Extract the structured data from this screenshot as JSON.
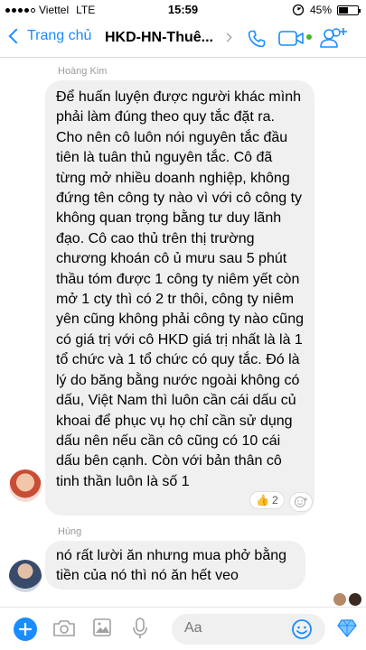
{
  "status_bar": {
    "carrier": "Viettel",
    "network": "LTE",
    "time": "15:59",
    "battery_percent": "45%",
    "battery_level": 0.45
  },
  "nav": {
    "back_label": "Trang chủ",
    "title": "HKD-HN-Thuê...",
    "icons": [
      "phone-icon",
      "video-icon",
      "add-people-icon"
    ]
  },
  "messages": [
    {
      "sender": "Hoàng Kim",
      "text": "Để huấn luyện được người khác mình phải làm đúng theo quy tắc đặt ra. Cho nên cô luôn nói nguyên tắc đầu tiên là tuân thủ nguyên tắc. Cô đã từng mở nhiều doanh nghiệp, không đứng tên công ty nào vì với cô công ty không quan trọng bằng tư duy lãnh đạo. Cô cao thủ trên thị trường chương khoán cô ủ mưu sau 5 phút thầu tóm được 1 công ty niêm yết còn mở 1 cty thì có 2 tr thôi, công ty niêm yên cũng không phải công ty nào cũng có giá trị với cô HKD giá trị nhất là là 1 tổ chức và 1 tổ chức có quy tắc. Đó là lý do băng bằng nước ngoài không có dấu, Việt Nam thì luôn cần cái dấu củ khoai để phục vụ họ chỉ cần sử dụng dấu nên nếu cần cô cũng có 10 cái dấu bên cạnh. Còn với bản thân cô tinh thần luôn là số 1",
      "reaction_emoji": "👍",
      "reaction_count": "2"
    },
    {
      "sender": "Hùng",
      "text": "nó rất lười ăn nhưng mua phở bằng tiền của nó thì nó ăn hết veo"
    }
  ],
  "composer": {
    "placeholder": "Aa",
    "icons": [
      "plus-icon",
      "camera-icon",
      "photo-icon",
      "microphone-icon",
      "emoji-icon",
      "gem-icon"
    ]
  },
  "colors": {
    "accent": "#1a8cff",
    "bubble": "#f1f0f0",
    "sender_label": "#9b9b9b"
  }
}
